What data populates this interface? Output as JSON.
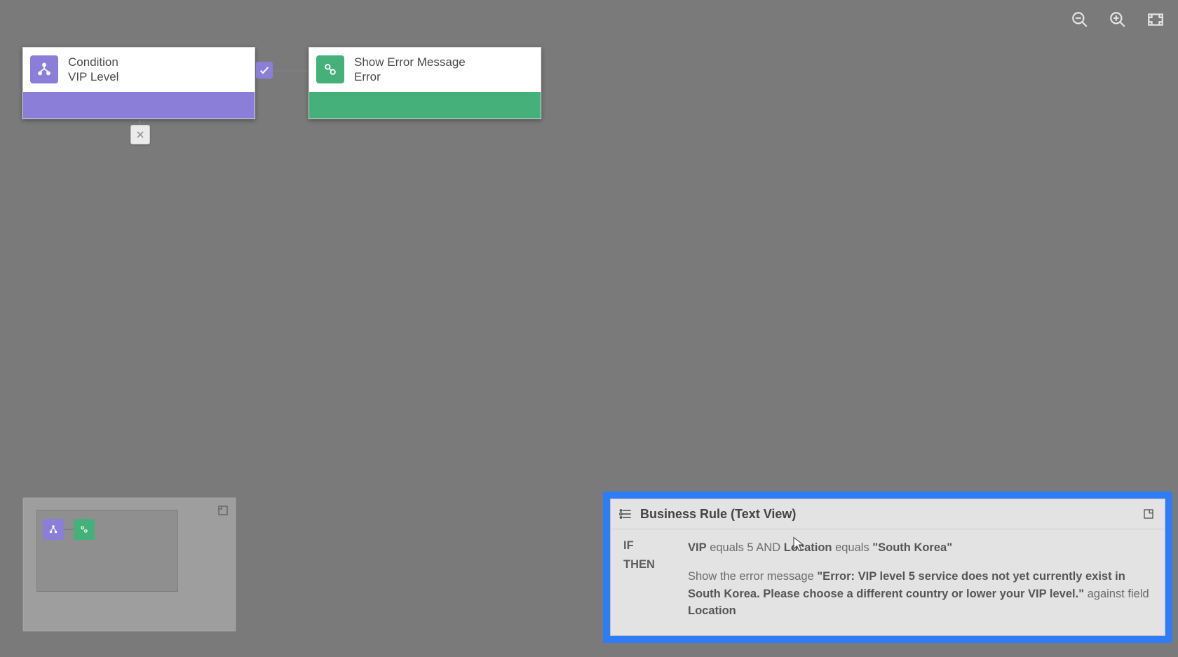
{
  "toolbar": {
    "zoom_out": "Zoom Out",
    "zoom_in": "Zoom In",
    "fit": "Fit to Screen"
  },
  "nodes": {
    "condition": {
      "label": "Condition",
      "subtitle": "VIP Level"
    },
    "action": {
      "label": "Show Error Message",
      "subtitle": "Error"
    }
  },
  "minimap": {
    "expand": "Expand"
  },
  "text_view": {
    "title": "Business Rule (Text View)",
    "if_label": "IF",
    "then_label": "THEN",
    "rule": {
      "if": {
        "field1": "VIP",
        "op1": "equals",
        "val1": "5",
        "conj": "AND",
        "field2": "Location",
        "op2": "equals",
        "val2": "\"South Korea\""
      },
      "then": {
        "prefix": "Show the error message",
        "message": "\"Error: VIP level 5 service does not yet currently exist in South Korea. Please choose a different country or lower your VIP level.\"",
        "suffix": "against field",
        "field": "Location"
      }
    }
  }
}
